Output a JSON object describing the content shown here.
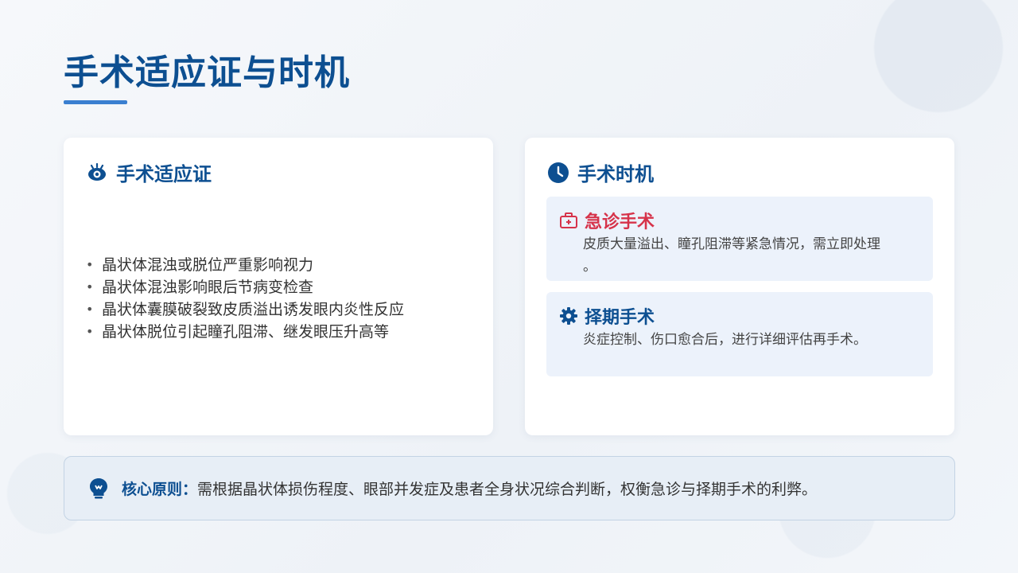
{
  "page": {
    "title": "手术适应证与时机"
  },
  "colors": {
    "primary": "#0d4f91",
    "accent": "#3a7fd0",
    "emergency": "#d6334a",
    "card_bg": "#ffffff",
    "sub_bg": "#ecf2fb"
  },
  "indications": {
    "icon": "eye-icon",
    "heading": "手术适应证",
    "items": [
      "晶状体混浊或脱位严重影响视力",
      "晶状体混浊影响眼后节病变检查",
      "晶状体囊膜破裂致皮质溢出诱发眼内炎性反应",
      "晶状体脱位引起瞳孔阻滞、继发眼压升高等"
    ]
  },
  "timing": {
    "icon": "clock-icon",
    "heading": "手术时机",
    "emergency": {
      "icon": "first-aid-kit-icon",
      "label": "急诊手术",
      "text_line1": "皮质大量溢出、瞳孔阻滞等紧急情况，需立即处理",
      "text_line2": "。"
    },
    "elective": {
      "icon": "gear-icon",
      "label": "择期手术",
      "text": "炎症控制、伤口愈合后，进行详细评估再手术。"
    }
  },
  "principle": {
    "icon": "lightbulb-icon",
    "label": "核心原则：",
    "text": "需根据晶状体损伤程度、眼部并发症及患者全身状况综合判断，权衡急诊与择期手术的利弊。"
  }
}
